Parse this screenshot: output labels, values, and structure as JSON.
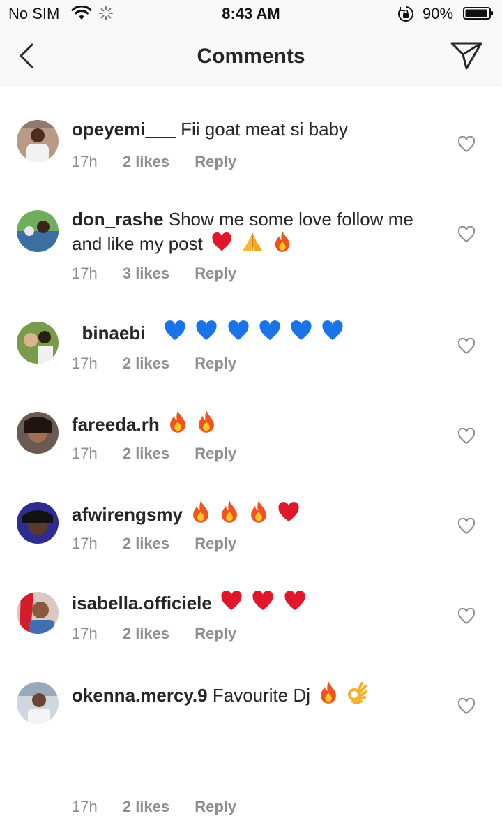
{
  "status_bar": {
    "carrier": "No SIM",
    "time": "8:43 AM",
    "battery": "90%"
  },
  "nav": {
    "title": "Comments"
  },
  "comments": [
    {
      "username": "opeyemi___",
      "text": "Fii goat meat si baby",
      "emojis": [],
      "time": "17h",
      "likes": "2 likes",
      "reply": "Reply"
    },
    {
      "username": "don_rashe",
      "text": "Show me some love follow me and like my post",
      "emojis": [
        "red-heart",
        "folded-hands",
        "fire"
      ],
      "time": "17h",
      "likes": "3 likes",
      "reply": "Reply"
    },
    {
      "username": "_binaebi_",
      "text": "",
      "emojis": [
        "blue-heart",
        "blue-heart",
        "blue-heart",
        "blue-heart",
        "blue-heart",
        "blue-heart"
      ],
      "time": "17h",
      "likes": "2 likes",
      "reply": "Reply"
    },
    {
      "username": "fareeda.rh",
      "text": "",
      "emojis": [
        "fire",
        "fire"
      ],
      "time": "17h",
      "likes": "2 likes",
      "reply": "Reply"
    },
    {
      "username": "afwirengsmy",
      "text": "",
      "emojis": [
        "fire",
        "fire",
        "fire",
        "red-heart"
      ],
      "time": "17h",
      "likes": "2 likes",
      "reply": "Reply"
    },
    {
      "username": "isabella.officiele",
      "text": "",
      "emojis": [
        "red-heart",
        "red-heart",
        "red-heart"
      ],
      "time": "17h",
      "likes": "2 likes",
      "reply": "Reply"
    },
    {
      "username": "okenna.mercy.9",
      "text": "Favourite Dj",
      "emojis": [
        "fire",
        "ok-hand"
      ],
      "time": "17h",
      "likes": "2 likes",
      "reply": "Reply"
    }
  ]
}
